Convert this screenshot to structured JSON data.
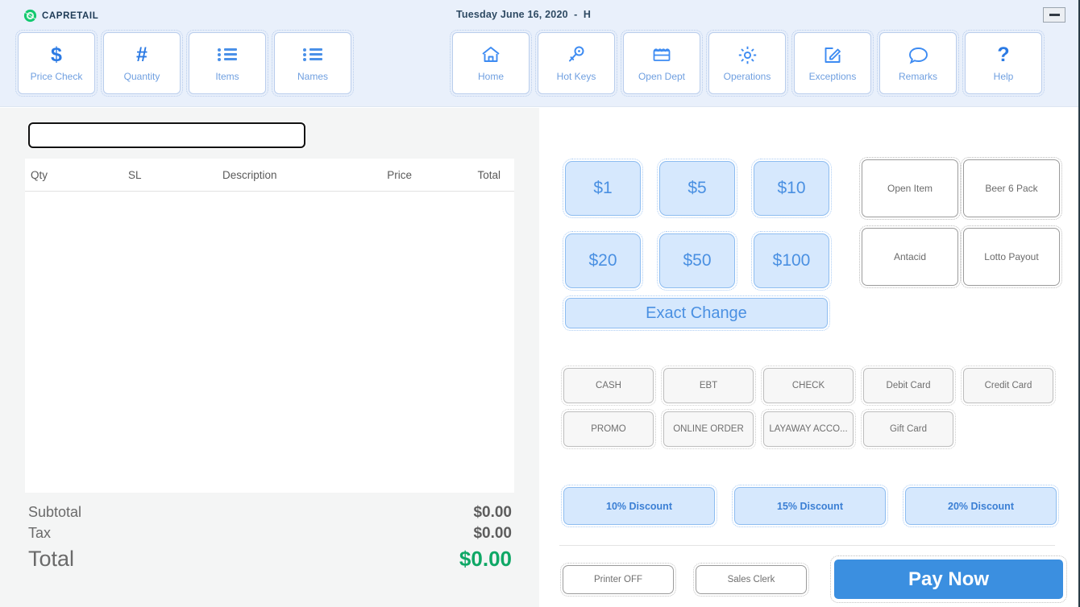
{
  "brand": {
    "name": "CAPRETAIL",
    "mark_icon": "capretail-logo-icon",
    "mark_color": "#12c96f",
    "text_color": "#1d3a55"
  },
  "header": {
    "datetime": "Tuesday June 16, 2020  -  H",
    "minimize_label": "",
    "accent": "#3b8fe0",
    "background": "#e9f0fb"
  },
  "toolbar_left": [
    {
      "label": "Price Check",
      "icon": "dollar-sign-icon",
      "glyph": "$"
    },
    {
      "label": "Quantity",
      "icon": "hash-icon",
      "glyph": "#"
    },
    {
      "label": "Items",
      "icon": "list-icon",
      "glyph": ""
    },
    {
      "label": "Names",
      "icon": "list-icon",
      "glyph": ""
    }
  ],
  "toolbar_right": [
    {
      "label": "Home",
      "icon": "home-icon"
    },
    {
      "label": "Hot Keys",
      "icon": "key-icon"
    },
    {
      "label": "Open Dept",
      "icon": "storefront-icon"
    },
    {
      "label": "Operations",
      "icon": "gear-icon"
    },
    {
      "label": "Exceptions",
      "icon": "edit-square-icon"
    },
    {
      "label": "Remarks",
      "icon": "speech-bubble-icon"
    },
    {
      "label": "Help",
      "icon": "question-mark-icon"
    }
  ],
  "ticket": {
    "input_value": "",
    "input_placeholder": "",
    "columns": [
      "Qty",
      "SL",
      "Description",
      "Price",
      "Total"
    ],
    "rows": []
  },
  "totals": {
    "subtotal_label": "Subtotal",
    "subtotal_value": "$0.00",
    "tax_label": "Tax",
    "tax_value": "$0.00",
    "total_label": "Total",
    "total_value": "$0.00",
    "total_color": "#0fa866"
  },
  "denominations": [
    "$1",
    "$5",
    "$10",
    "$20",
    "$50",
    "$100"
  ],
  "exact_change_label": "Exact Change",
  "quick_keys": [
    "Open Item",
    "Beer 6 Pack",
    "Antacid",
    "Lotto Payout"
  ],
  "payment_methods": [
    "CASH",
    "EBT",
    "CHECK",
    "Debit Card",
    "Credit Card",
    "PROMO",
    "ONLINE ORDER",
    "LAYAWAY  ACCO...",
    "Gift Card"
  ],
  "discounts": [
    "10% Discount",
    "15% Discount",
    "20% Discount"
  ],
  "footer": {
    "printer_label": "Printer OFF",
    "sales_clerk_label": "Sales Clerk",
    "pay_now_label": "Pay Now",
    "pay_now_color": "#3b8fe0"
  }
}
